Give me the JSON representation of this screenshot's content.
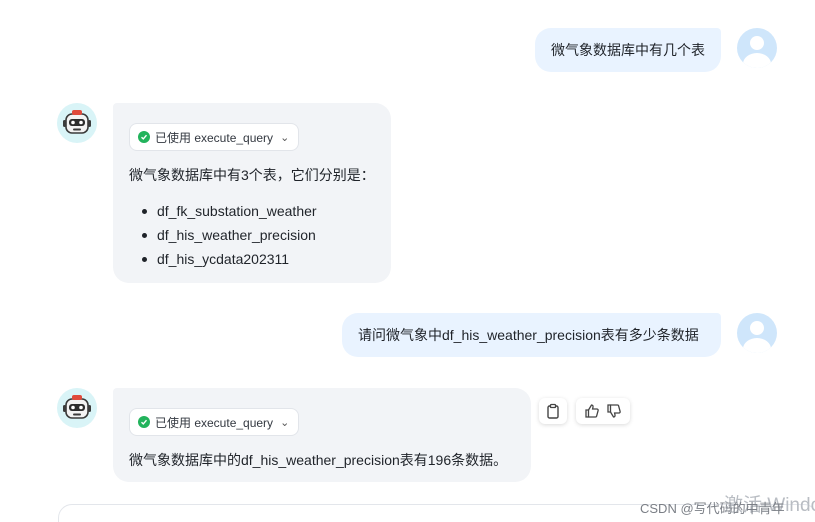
{
  "messages": {
    "q1": {
      "text": "微气象数据库中有几个表"
    },
    "a1": {
      "tool_label": "已使用 execute_query",
      "intro": "微气象数据库中有3个表，它们分别是：",
      "tables": [
        "df_fk_substation_weather",
        "df_his_weather_precision",
        "df_his_ycdata202311"
      ]
    },
    "q2": {
      "text": "请问微气象中df_his_weather_precision表有多少条数据"
    },
    "a2": {
      "tool_label": "已使用 execute_query",
      "answer": "微气象数据库中的df_his_weather_precision表有196条数据。"
    }
  },
  "actions": {
    "icons": [
      "clipboard-icon",
      "thumbs-up-icon",
      "thumbs-down-icon"
    ]
  },
  "watermarks": {
    "csdn": "CSDN @写代码的中青年",
    "windows": "激活 Windo"
  },
  "colors": {
    "user_bubble": "#e9f3ff",
    "bot_bubble": "#f2f4f7",
    "check": "#22b35c",
    "user_avatar": "#cfe6fb",
    "bot_avatar": "#d9f4f7"
  }
}
